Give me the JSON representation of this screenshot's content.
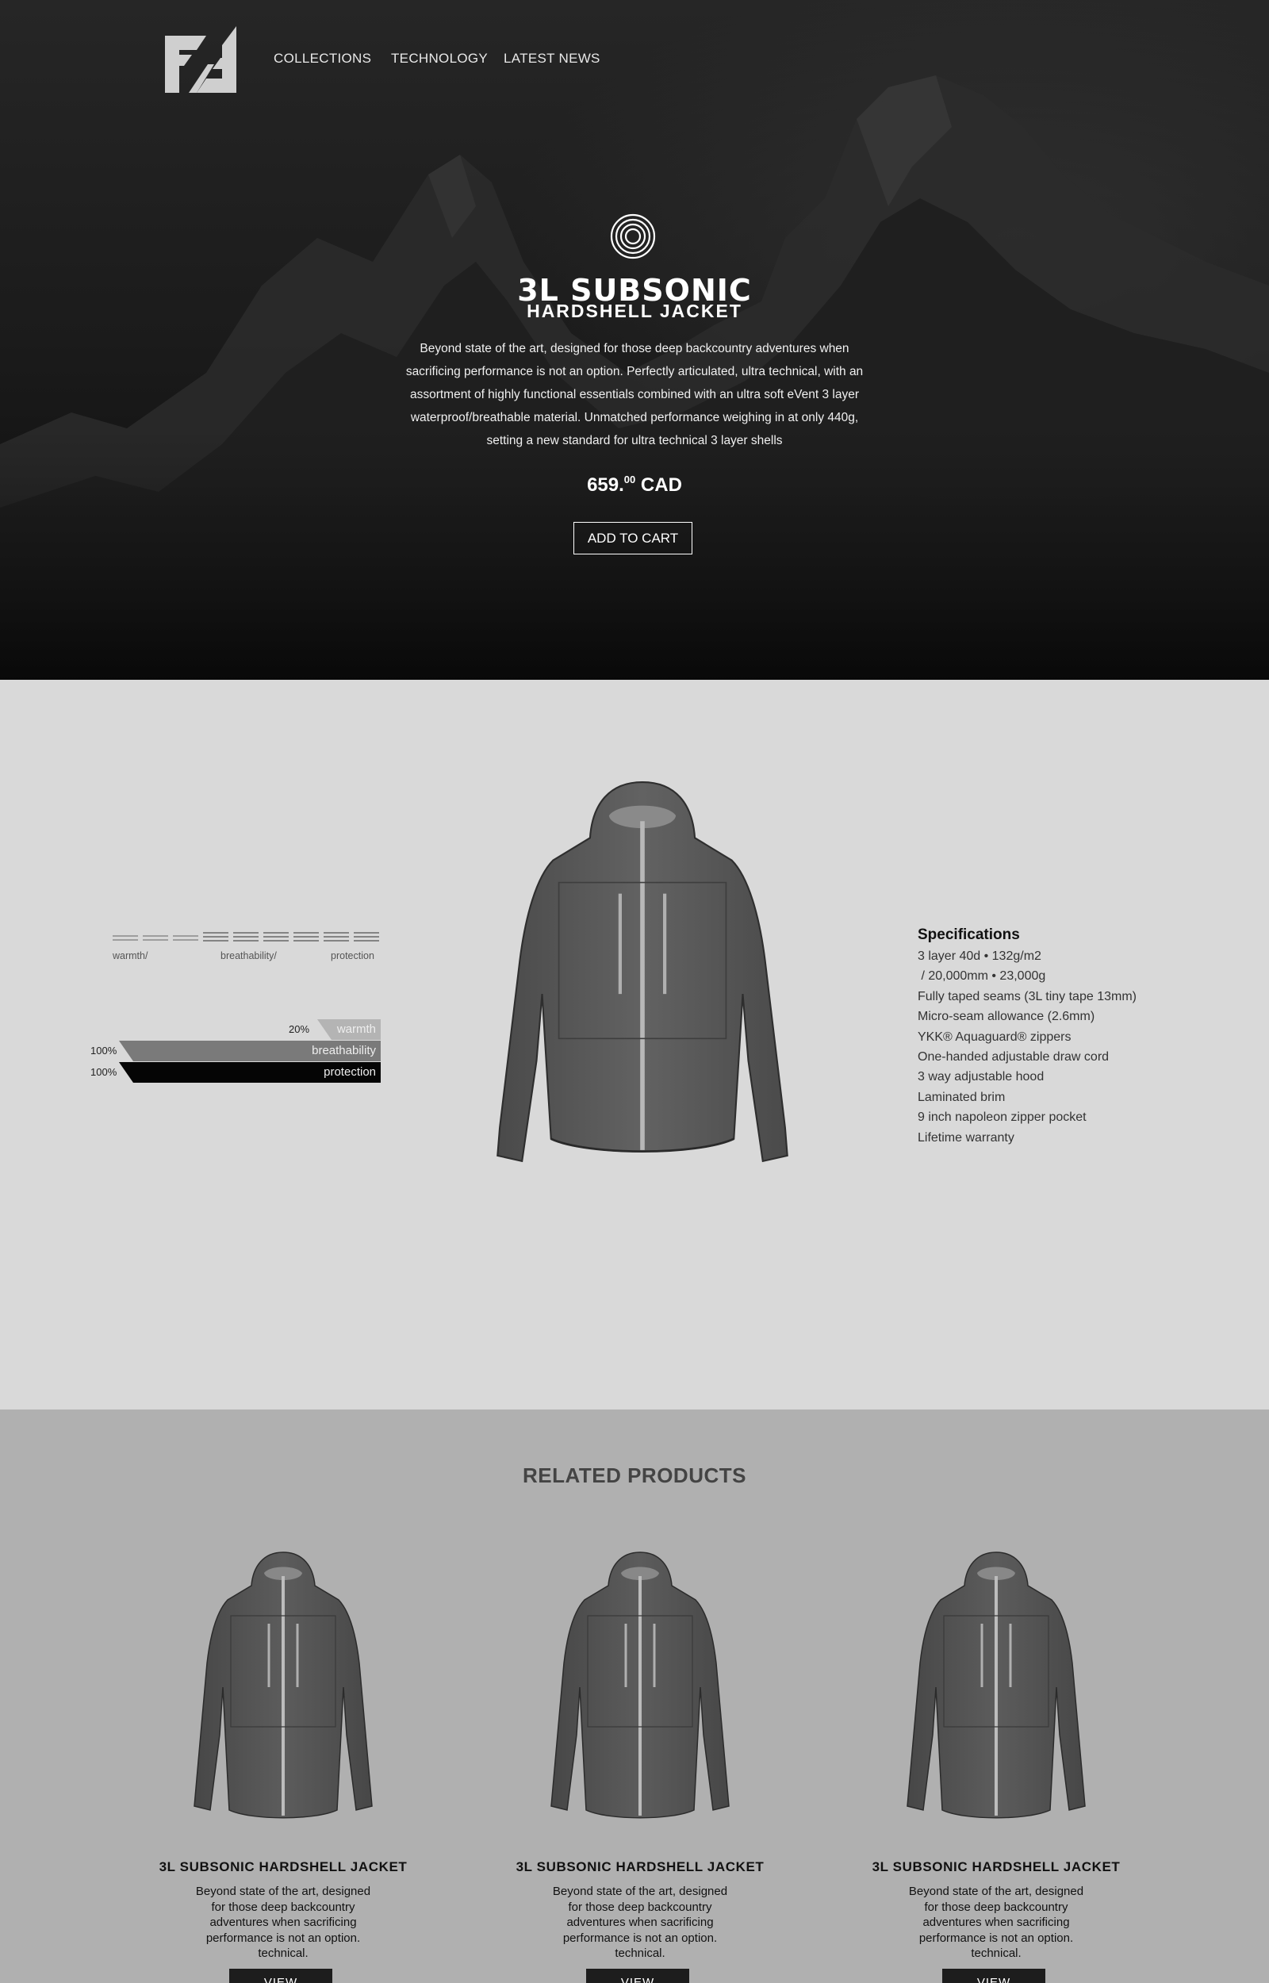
{
  "nav": {
    "logo_icon": "brand-monogram-icon",
    "links": [
      "COLLECTIONS",
      "TECHNOLOGY",
      "LATEST NEWS"
    ]
  },
  "hero": {
    "icon": "concentric-circles-icon",
    "title": "3L SUBSONIC",
    "subtitle": "HARDSHELL JACKET",
    "description": "Beyond state of the art, designed for those deep backcountry adventures when sacrificing performance is not an option. Perfectly articulated, ultra technical, with an assortment of highly functional essentials combined with an ultra soft eVent 3 layer waterproof/breathable material. Unmatched performance weighing in at only 440g, setting a new standard for ultra technical 3 layer shells",
    "price_main": "659.",
    "price_cents": "00",
    "price_currency": "CAD",
    "cta_label": "ADD TO CART"
  },
  "ratings": {
    "scale_labels": [
      "warmth/",
      "breathability/",
      "protection"
    ],
    "bars": [
      {
        "label": "warmth",
        "pct_text": "20%",
        "value": 0.2,
        "color": "#b4b4b4"
      },
      {
        "label": "breathability",
        "pct_text": "100%",
        "value": 1.0,
        "color": "#7a7a7a"
      },
      {
        "label": "protection",
        "pct_text": "100%",
        "value": 1.0,
        "color": "#050505"
      }
    ]
  },
  "specs": {
    "title": "Specifications",
    "items": [
      "3 layer 40d • 132g/m2",
      " / 20,000mm • 23,000g",
      "Fully taped seams (3L tiny tape 13mm)",
      "Micro-seam allowance (2.6mm)",
      "YKK® Aquaguard® zippers",
      "One-handed adjustable draw cord",
      "3 way adjustable hood",
      "Laminated brim",
      "9 inch napoleon zipper pocket",
      "Lifetime warranty"
    ]
  },
  "related": {
    "title": "RELATED PRODUCTS",
    "products": [
      {
        "name": "3L SUBSONIC HARDSHELL JACKET",
        "description": "Beyond state of the art, designed for those deep backcountry adventures when sacrificing performance is not an option. technical.",
        "button": "VIEW"
      },
      {
        "name": "3L SUBSONIC HARDSHELL JACKET",
        "description": "Beyond state of the art, designed for those deep backcountry adventures when sacrificing performance is not an option. technical.",
        "button": "VIEW"
      },
      {
        "name": "3L SUBSONIC HARDSHELL JACKET",
        "description": "Beyond state of the art, designed for those deep backcountry adventures when sacrificing performance is not an option. technical.",
        "button": "VIEW"
      }
    ]
  },
  "colors": {
    "hero_bg": "#141414",
    "detail_bg": "#d9d9d9",
    "related_bg": "#b0b0b0",
    "jacket": "#5a5a5a",
    "zipper": "#b8b8b8"
  }
}
